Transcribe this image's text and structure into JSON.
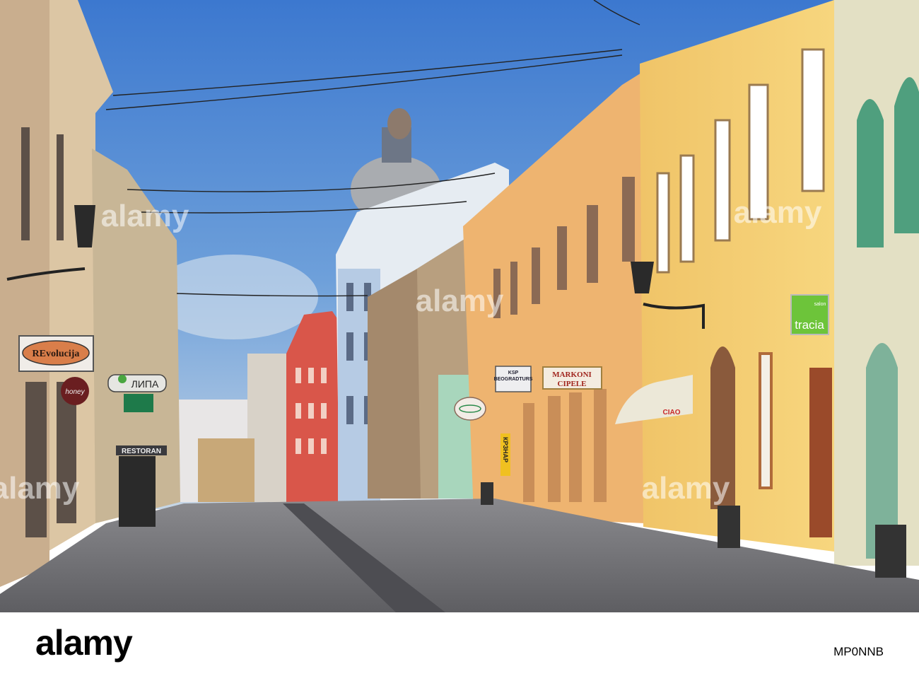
{
  "photo": {
    "description_label": "Street scene",
    "signs": {
      "revolucija": "REvolucija",
      "honey": "honey",
      "lipa": "ЛИПА",
      "restoran": "RESTORAN",
      "ksp_line1": "KSP",
      "ksp_line2": "BEOGRADTURS",
      "markoni_line1": "MARKONI",
      "markoni_line2": "CIPELE",
      "krznar": "КРЗНАР",
      "ciao": "CIAO",
      "tracia": "tracia",
      "tracia_small": "salon"
    },
    "watermark": "alamy"
  },
  "footer": {
    "logo": "alamy",
    "image_code": "MP0NNB"
  },
  "colors": {
    "sky_top": "#3c78cf",
    "sky_bottom": "#b9cde2",
    "yellow_building": "#f2c86a",
    "orange_building": "#eeb470",
    "red_building": "#d9564a",
    "street": "#6e6d70"
  }
}
